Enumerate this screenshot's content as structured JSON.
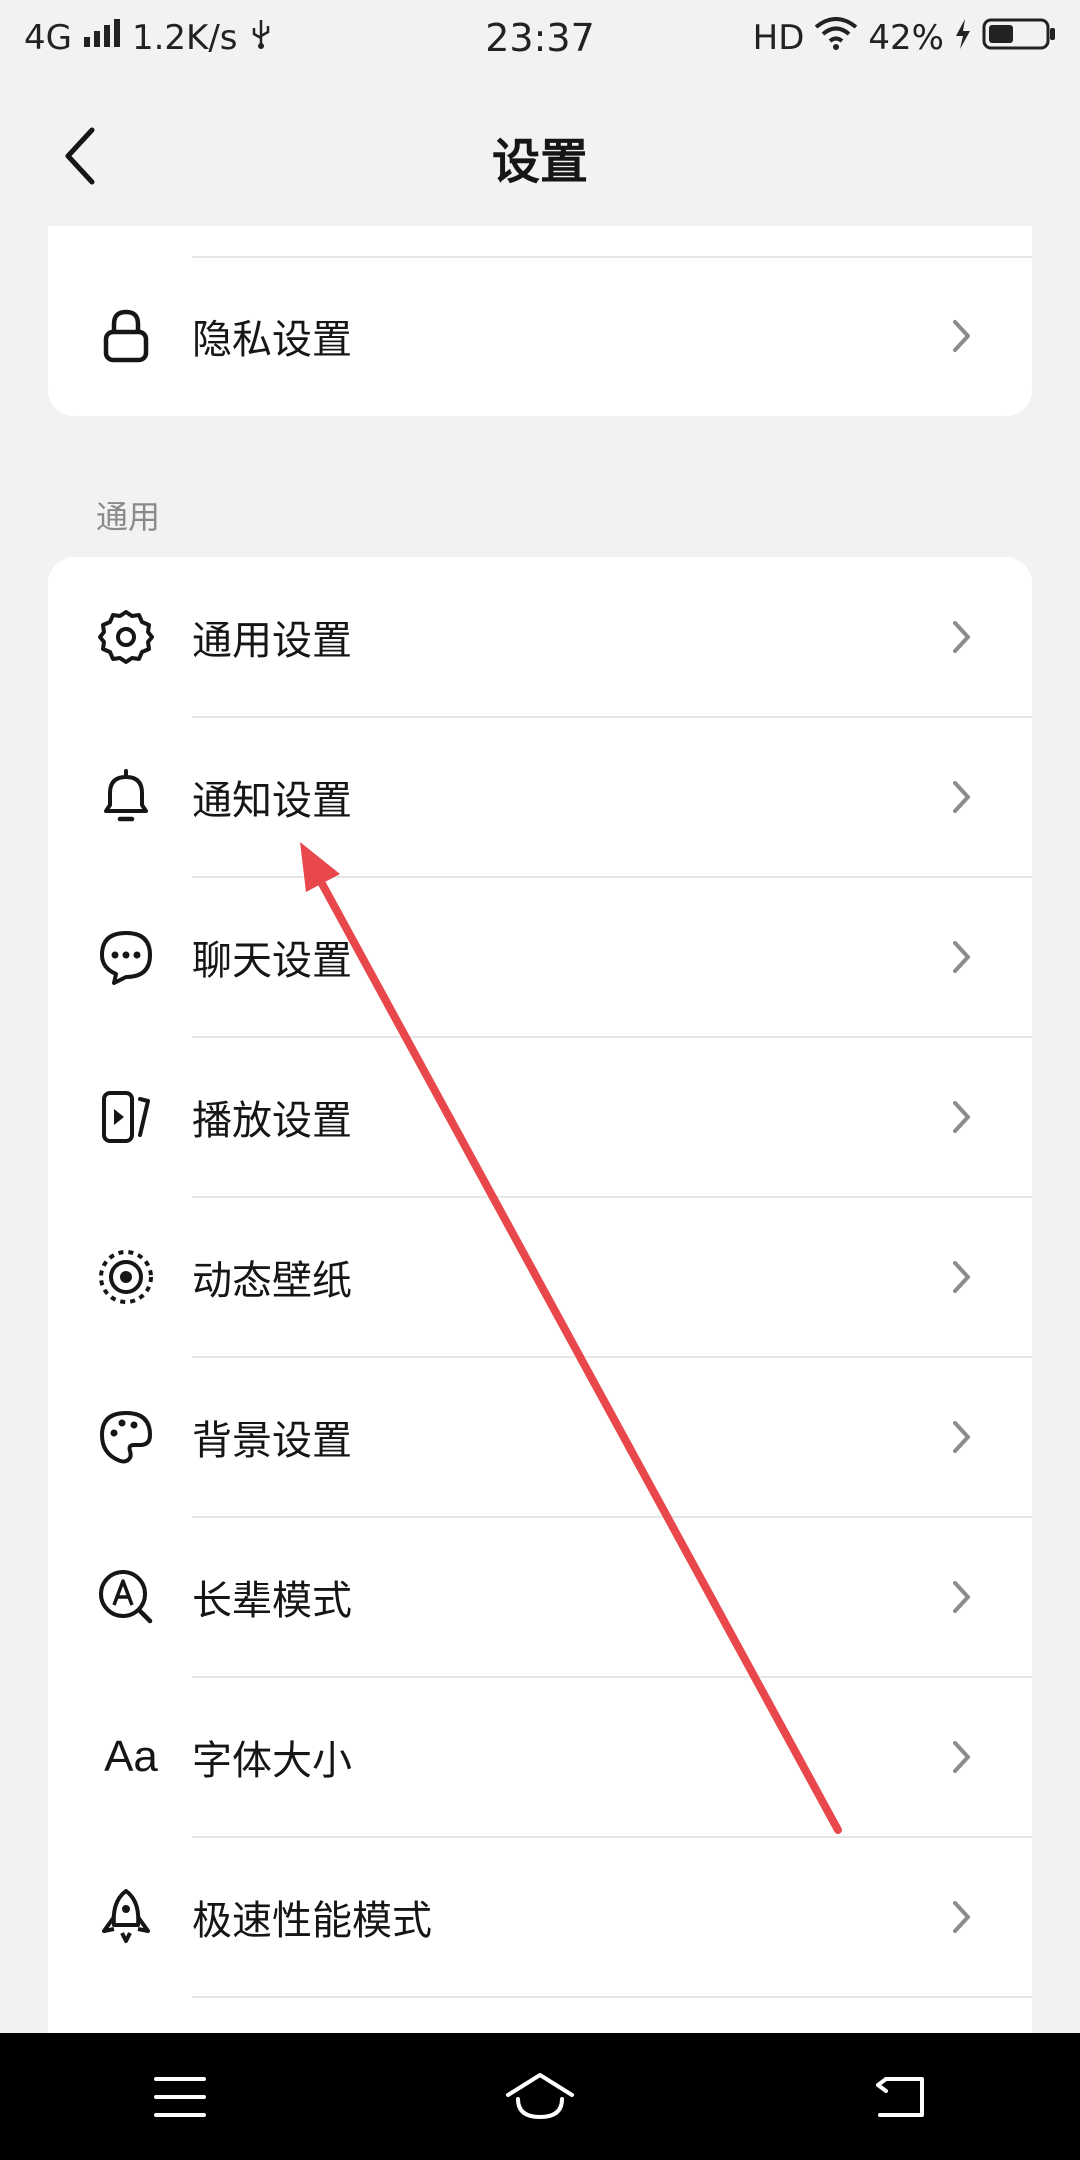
{
  "status_bar": {
    "network": "4G",
    "speed": "1.2K/s",
    "time": "23:37",
    "hd": "HD",
    "battery": "42%"
  },
  "header": {
    "title": "设置",
    "back_icon": "chevron-left-icon"
  },
  "top_card": {
    "items": [
      {
        "label": "隐私设置",
        "icon": "lock-icon"
      }
    ]
  },
  "section": {
    "title": "通用"
  },
  "general_card": {
    "items": [
      {
        "label": "通用设置",
        "icon": "gear-icon"
      },
      {
        "label": "通知设置",
        "icon": "bell-icon"
      },
      {
        "label": "聊天设置",
        "icon": "chat-bubble-icon"
      },
      {
        "label": "播放设置",
        "icon": "play-device-icon"
      },
      {
        "label": "动态壁纸",
        "icon": "live-wallpaper-icon"
      },
      {
        "label": "背景设置",
        "icon": "palette-icon"
      },
      {
        "label": "长辈模式",
        "icon": "elder-mode-icon"
      },
      {
        "label": "字体大小",
        "icon": "font-size-icon",
        "icon_text": "Aa"
      },
      {
        "label": "极速性能模式",
        "icon": "rocket-icon"
      }
    ]
  },
  "annotation": {
    "type": "red-arrow",
    "color": "#e8474b",
    "points_to": "通知设置"
  },
  "system_nav": {
    "menu_icon": "menu-icon",
    "home_icon": "home-icon",
    "back_icon": "back-icon"
  },
  "colors": {
    "background": "#f2f2f2",
    "card": "#ffffff",
    "text": "#161616",
    "secondary_text": "#8a8a8a",
    "chevron": "#8c8c8c",
    "arrow": "#e8474b"
  }
}
